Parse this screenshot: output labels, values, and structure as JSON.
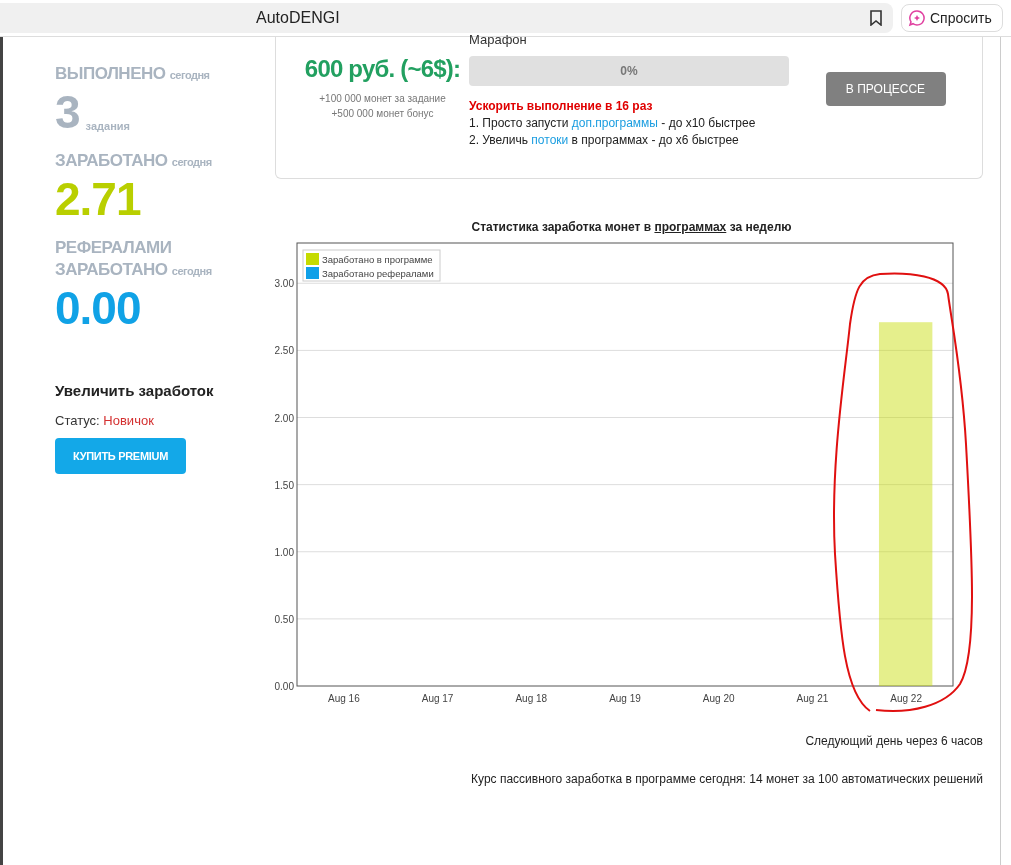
{
  "browser": {
    "title": "AutoDENGI",
    "ask_button": "Спросить"
  },
  "stats": [
    {
      "label": "ВЫПОЛНЕНО",
      "sublabel": "сегодня",
      "value": "3",
      "unit": "задания",
      "color": "#a9b4c0"
    },
    {
      "label": "ЗАРАБОТАНО",
      "sublabel": "сегодня",
      "value": "2.71",
      "color": "#b9cf00"
    },
    {
      "label": "РЕФЕРАЛАМИ ЗАРАБОТАНО",
      "sublabel": "сегодня",
      "value": "0.00",
      "color": "#10a2e6"
    }
  ],
  "boost": {
    "title": "Увеличить заработок",
    "status_label": "Статус:",
    "status_value": "Новичок",
    "button": "КУПИТЬ PREMIUM"
  },
  "task": {
    "heading": "Марафон",
    "reward": "600 руб. (~6$):",
    "notes": [
      "+100 000 монет за задание",
      "+500 000 монет бонус"
    ],
    "progress": {
      "level": 0,
      "text": "0%"
    },
    "speedup_title": "Ускорить выполнение в 16 раз",
    "tips": [
      {
        "before": "1. Просто запусти ",
        "link": "доп.программы",
        "after": " - до x10 быстрее"
      },
      {
        "before": "2. Увеличь ",
        "link": "потоки",
        "after": " в программах - до x6 быстрее"
      }
    ],
    "button": "В ПРОЦЕССЕ"
  },
  "chart": {
    "title_before": "Статистика заработка монет в ",
    "title_link": "программах",
    "title_after": " за неделю",
    "chart_data": {
      "type": "bar",
      "categories": [
        "Aug 16",
        "Aug 17",
        "Aug 18",
        "Aug 19",
        "Aug 20",
        "Aug 21",
        "Aug 22"
      ],
      "series": [
        {
          "name": "Заработано в программе",
          "color": "#c5db00",
          "values": [
            0,
            0,
            0,
            0,
            0,
            0,
            2.71
          ]
        },
        {
          "name": "Заработано рефералами",
          "color": "#0fa0e8",
          "values": [
            0,
            0,
            0,
            0,
            0,
            0,
            0
          ]
        }
      ],
      "ylim": [
        0,
        3.3
      ],
      "yticks": [
        {
          "value": 0,
          "label": "0.00"
        },
        {
          "value": 0.5,
          "label": "0.50"
        },
        {
          "value": 1,
          "label": "1.00"
        },
        {
          "value": 1.5,
          "label": "1.50"
        },
        {
          "value": 2,
          "label": "2.00"
        },
        {
          "value": 2.5,
          "label": "2.50"
        },
        {
          "value": 3,
          "label": "3.00"
        }
      ],
      "grid": true
    }
  },
  "footer": [
    "Следующий день через 6 часов",
    "Курс пассивного заработка в программе сегодня: 14 монет за 100 автоматических решений"
  ]
}
